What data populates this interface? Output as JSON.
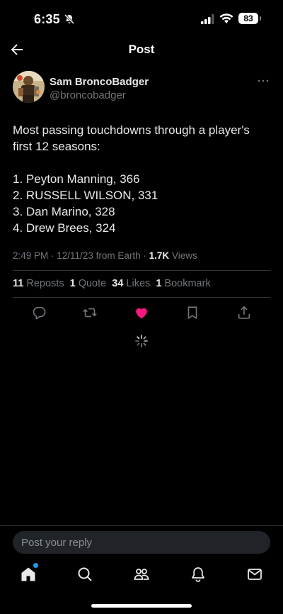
{
  "status_bar": {
    "time": "6:35",
    "battery": "83"
  },
  "header": {
    "title": "Post"
  },
  "author": {
    "name": "Sam BroncoBadger",
    "handle": "@broncobadger"
  },
  "post": {
    "intro": "Most passing touchdowns through a player's first 12 seasons:",
    "list": [
      "1. Peyton Manning, 366",
      "2. RUSSELL WILSON, 331",
      "3. Dan Marino, 328",
      "4. Drew Brees, 324"
    ]
  },
  "meta": {
    "time": "2:49 PM",
    "date": "12/11/23",
    "source": "from Earth",
    "views_count": "1.7K",
    "views_label": "Views"
  },
  "stats": {
    "reposts_count": "11",
    "reposts_label": "Reposts",
    "quotes_count": "1",
    "quotes_label": "Quote",
    "likes_count": "34",
    "likes_label": "Likes",
    "bookmarks_count": "1",
    "bookmarks_label": "Bookmark"
  },
  "reply": {
    "placeholder": "Post your reply"
  },
  "colors": {
    "background": "#000000",
    "text": "#e7e9ea",
    "muted": "#71767b",
    "like": "#f91880",
    "accent": "#1d9bf0"
  },
  "icons": [
    "back-arrow-icon",
    "more-icon",
    "reply-icon",
    "repost-icon",
    "like-icon",
    "bookmark-icon",
    "share-icon",
    "home-icon",
    "search-icon",
    "communities-icon",
    "notifications-icon",
    "messages-icon"
  ]
}
